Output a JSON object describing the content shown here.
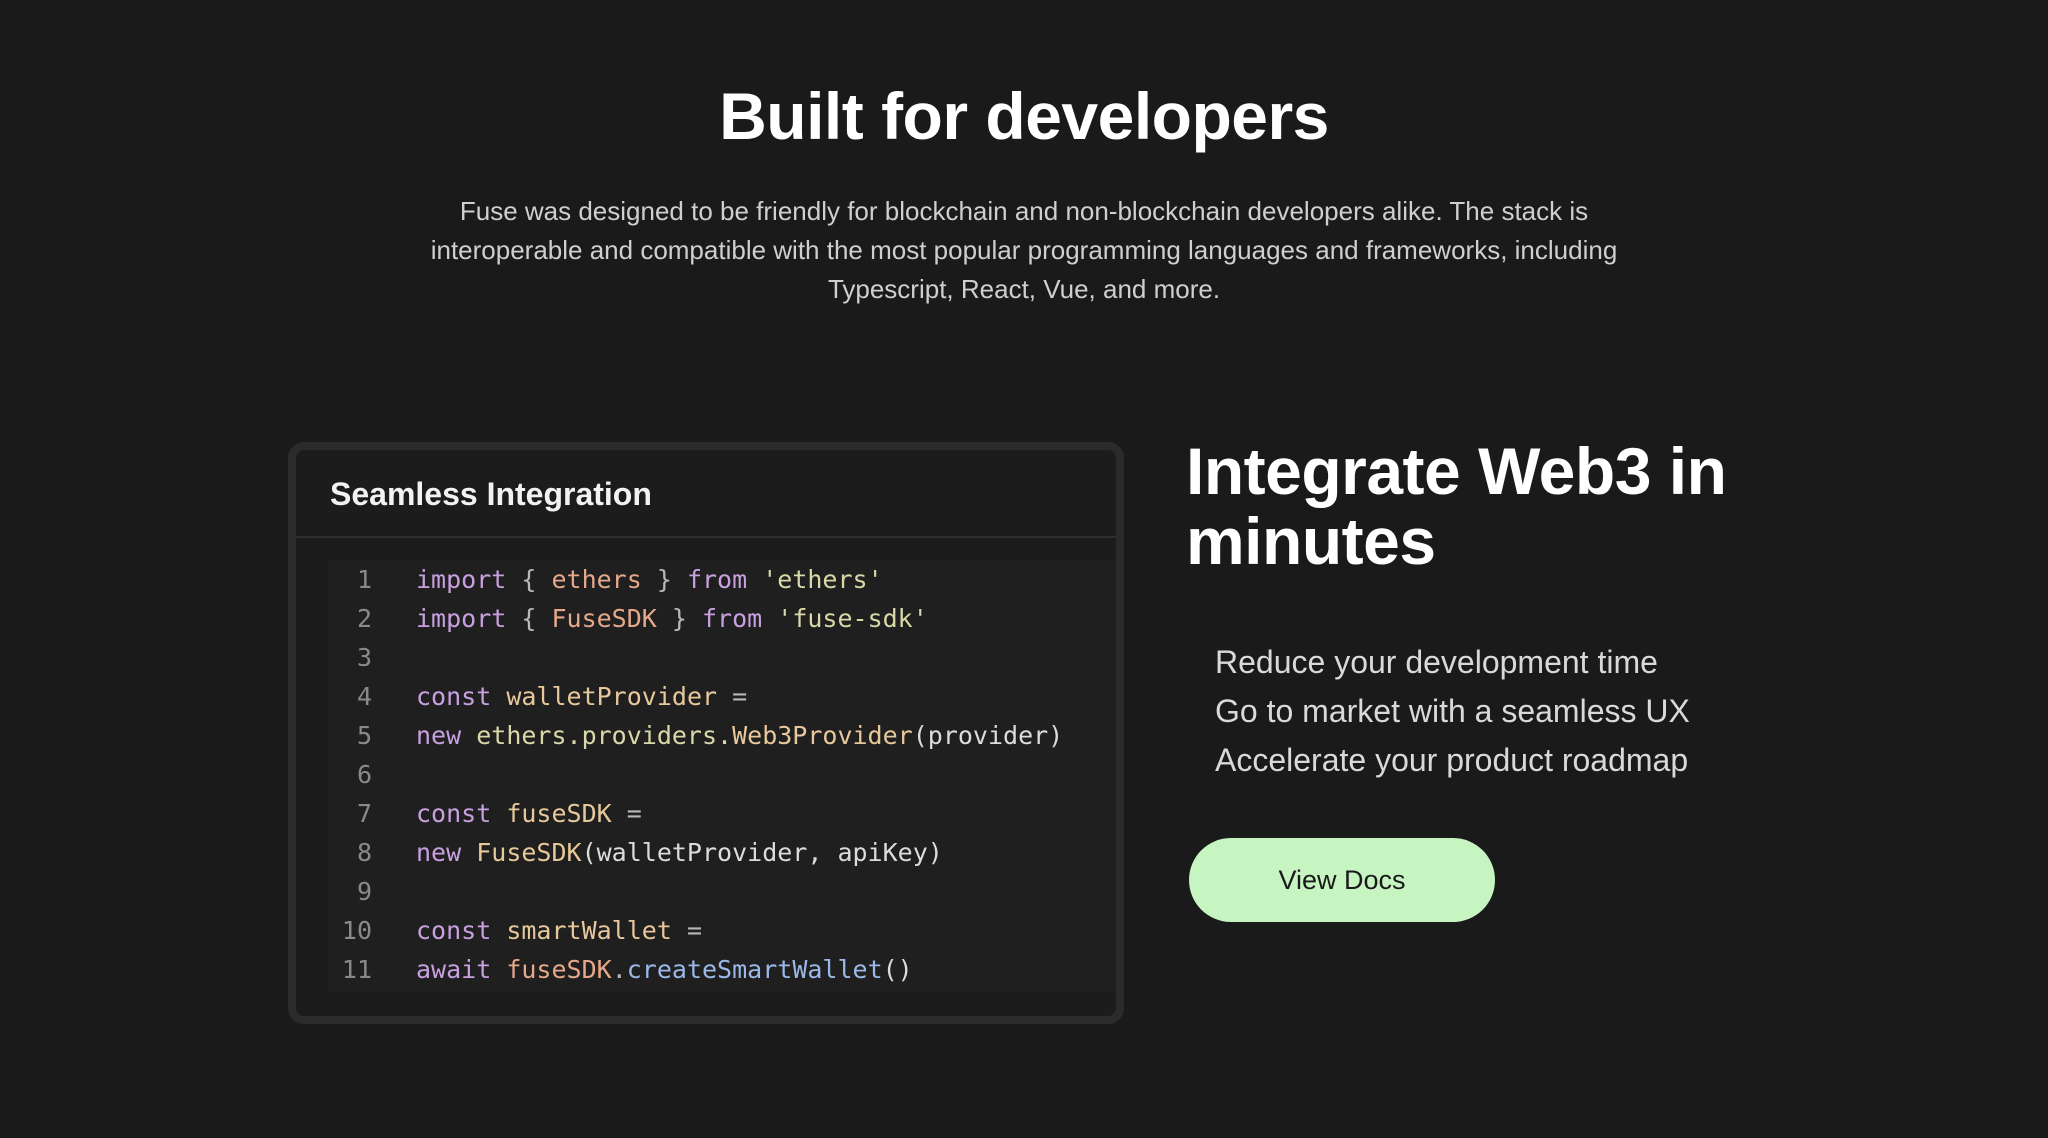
{
  "hero": {
    "title": "Built for developers",
    "description_lines": [
      "Fuse was designed to be friendly for blockchain and non-blockchain developers alike. The stack is",
      "interoperable and compatible with the most popular programming languages and frameworks, including",
      "Typescript, React, Vue, and more."
    ]
  },
  "code_card": {
    "title": "Seamless Integration",
    "lines": [
      {
        "n": "1",
        "tokens": [
          [
            "kw",
            "import"
          ],
          [
            "op",
            " { "
          ],
          [
            "id",
            "ethers"
          ],
          [
            "op",
            " } "
          ],
          [
            "kw",
            "from"
          ],
          [
            "pl",
            " "
          ],
          [
            "str",
            "'ethers'"
          ]
        ]
      },
      {
        "n": "2",
        "tokens": [
          [
            "kw",
            "import"
          ],
          [
            "op",
            " { "
          ],
          [
            "id",
            "FuseSDK"
          ],
          [
            "op",
            " } "
          ],
          [
            "kw",
            "from"
          ],
          [
            "pl",
            " "
          ],
          [
            "str",
            "'fuse-sdk'"
          ]
        ]
      },
      {
        "n": "3",
        "tokens": []
      },
      {
        "n": "4",
        "tokens": [
          [
            "kw",
            "const"
          ],
          [
            "pl",
            " "
          ],
          [
            "fn",
            "walletProvider"
          ],
          [
            "op",
            " ="
          ]
        ]
      },
      {
        "n": "5",
        "tokens": [
          [
            "kw",
            "new"
          ],
          [
            "pl",
            " "
          ],
          [
            "str",
            "ethers.providers."
          ],
          [
            "fn",
            "Web3Provider"
          ],
          [
            "pl",
            "(provider)"
          ]
        ]
      },
      {
        "n": "6",
        "tokens": []
      },
      {
        "n": "7",
        "tokens": [
          [
            "kw",
            "const"
          ],
          [
            "pl",
            " "
          ],
          [
            "fn",
            "fuseSDK"
          ],
          [
            "op",
            " ="
          ]
        ]
      },
      {
        "n": "8",
        "tokens": [
          [
            "kw",
            "new"
          ],
          [
            "pl",
            " "
          ],
          [
            "fn",
            "FuseSDK"
          ],
          [
            "pl",
            "(walletProvider, apiKey)"
          ]
        ]
      },
      {
        "n": "9",
        "tokens": []
      },
      {
        "n": "10",
        "tokens": [
          [
            "kw",
            "const"
          ],
          [
            "pl",
            " "
          ],
          [
            "fn",
            "smartWallet"
          ],
          [
            "op",
            " ="
          ]
        ]
      },
      {
        "n": "11",
        "tokens": [
          [
            "kw",
            "await"
          ],
          [
            "pl",
            " "
          ],
          [
            "id",
            "fuseSDK"
          ],
          [
            "op",
            "."
          ],
          [
            "meth",
            "createSmartWallet"
          ],
          [
            "pl",
            "()"
          ]
        ]
      }
    ]
  },
  "feature": {
    "title_lines": [
      "Integrate Web3 in",
      "minutes"
    ],
    "items": [
      "Reduce your development time",
      "Go to market with a seamless UX",
      "Accelerate your product roadmap"
    ],
    "button_label": "View Docs"
  },
  "colors": {
    "background": "#1a1a1a",
    "button": "#c7f5c2",
    "keyword": "#c8a0e0",
    "identifier": "#e6a88a",
    "string": "#d8d8a8"
  }
}
